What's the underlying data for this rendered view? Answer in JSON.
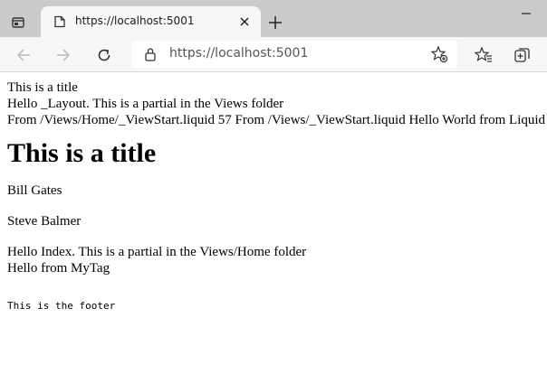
{
  "browser": {
    "tab_title": "https://localhost:5001",
    "url": "https://localhost:5001",
    "icons": {
      "window_menu": "window-menu-icon",
      "favicon": "page-favicon-icon",
      "close": "close-icon",
      "new_tab": "plus-icon",
      "minimize": "minimize-icon",
      "back": "back-arrow-icon",
      "forward": "forward-arrow-icon",
      "refresh": "refresh-icon",
      "lock": "lock-icon",
      "add_favorite": "star-plus-icon",
      "favorites": "favorites-icon",
      "collections": "collections-icon"
    },
    "colors": {
      "tabstrip": "#cbcbcb",
      "toolbar": "#f7f7f7",
      "address_bar": "#ffffff"
    }
  },
  "page": {
    "layout_title": "This is a title",
    "layout_partial": "Hello _Layout. This is a partial in the Views folder",
    "viewstart_line": "From /Views/Home/_ViewStart.liquid 57 From /Views/_ViewStart.liquid Hello World from Liquid",
    "heading": "This is a title",
    "people": [
      "Bill Gates",
      "Steve Balmer"
    ],
    "index_partial": "Hello Index. This is a partial in the Views/Home folder",
    "mytag": "Hello from MyTag",
    "footer": "This is the footer"
  }
}
